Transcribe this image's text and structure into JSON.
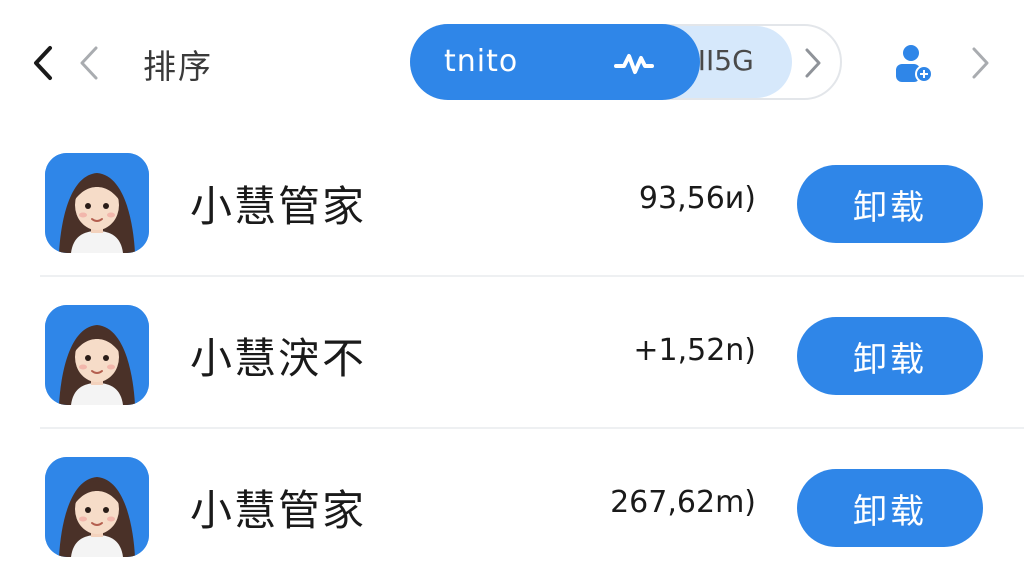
{
  "header": {
    "sort_label": "排序",
    "user_icon": "user-add-icon"
  },
  "segments": [
    {
      "label": "tnito",
      "icon": "wave-icon",
      "active": true
    },
    {
      "label": "ıII5G",
      "active": false
    }
  ],
  "apps": [
    {
      "name": "小慧管家",
      "size": "93,56ᴎ)",
      "action": "卸载"
    },
    {
      "name": "小慧涋不",
      "size": "+1,52n)",
      "action": "卸载"
    },
    {
      "name": "小慧管家",
      "size": "267,62m)",
      "action": "卸载"
    }
  ],
  "colors": {
    "accent": "#2f86e8",
    "accent_light": "#d6e8fb",
    "divider": "#eef0f2"
  }
}
